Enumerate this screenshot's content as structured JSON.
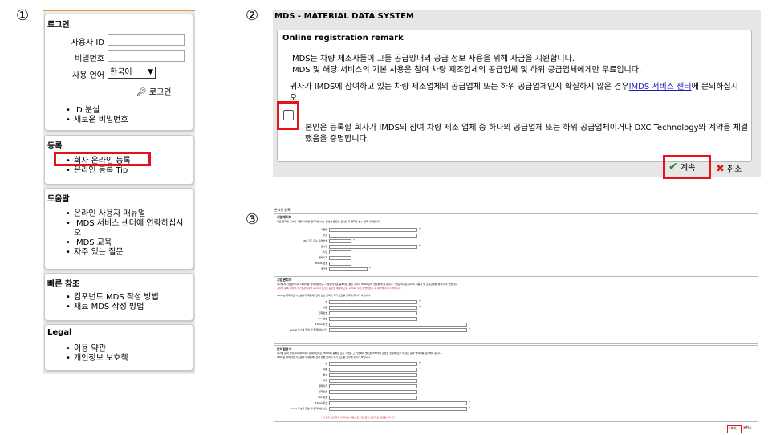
{
  "steps": [
    "①",
    "②",
    "③"
  ],
  "nav": {
    "login": {
      "title": "로그인",
      "user_id_label": "사용자 ID",
      "user_id_value": "",
      "password_label": "비밀번호",
      "password_value": "",
      "language_label": "사용 언어",
      "language_selected": "한국어",
      "login_button": "로그인",
      "links": [
        "ID 분실",
        "새로운 비밀번호"
      ]
    },
    "registration": {
      "title": "등록",
      "links": [
        "회사 온라인 등록",
        "온라인 등록 Tip"
      ]
    },
    "help": {
      "title": "도움말",
      "links": [
        "온라인 사용자 매뉴얼",
        "IMDS 서비스 센터에 연락하십시오",
        "IMDS 교육",
        "자주 있는 질문"
      ]
    },
    "quick": {
      "title": "빠른 참조",
      "links": [
        "컴포넌트 MDS 작성 방법",
        "재료 MDS 작성 방법"
      ]
    },
    "legal": {
      "title": "Legal",
      "links": [
        "이용 약관",
        "개인정보 보호책"
      ]
    }
  },
  "remark": {
    "system_title": "MDS - MATERIAL DATA SYSTEM",
    "box_title": "Online registration remark",
    "para1_line1": "IMDS는 차량 제조사들이 그들 공급망내의 공급 정보 사용을 위해 자금을 지원합니다.",
    "para1_line2": "IMDS 및 해당 서비스의 기본 사용은 참여 차량 제조업체의 공급업체 및 하위 공급업체에게만 무료입니다.",
    "para2_before": "귀사가 IMDS에 참여하고 있는 차량 제조업체의 공급업체 또는 하위 공급업체인지 확실하지 않은 경우",
    "para2_link": "IMDS 서비스 센터",
    "para2_after": "에 문의하십시오.",
    "consent_line1": "본인은 등록할 회사가 IMDS의 참여 차량 제조 업체 중 하나의 공급업체 또는 하위 공급업체이거나 DXC Technology와 계약을 체결",
    "consent_line2": "했음을 증명합니다.",
    "continue_button": "계속",
    "cancel_button": "취소"
  },
  "form": {
    "title": "온라인 등록",
    "sections": [
      {
        "title": "기업데이터",
        "desc": "다음 항목에 귀사의 기업데이터를 입력하십시오. 본인의 별표로 표시된 각 항목은 필수 입력 사항입니다.",
        "fields": [
          "기업명",
          "주소",
          "Zip 코드 또는 우편번호",
          "도시명",
          "주/도",
          "웹페이지",
          "DUNS 번호",
          "국가명"
        ]
      },
      {
        "title": "기업관리자",
        "desc": "여기에서 기업관리자의 데이터를 입력하십시오. 기업관리자로 등록되는 분은 귀사의 IMDS 관리 업무를 맡게 됩니다. 기업관리자는 귀사의 사용자 및 조직단위를 생성할 수 있습니다.",
        "desc_red": "귀사의 등록 데이터가 기업관리자의 e-mail 주소로 승인될 예정이므로, e-mail 주소가 올바른지 꼭 확인해 주시기 바랍니다.",
        "desc2": "IMDS는 국제적인 시스템이기 때문에, 전화 번호 입력시 국가 코드를 입력해 주시기 바랍니다.",
        "fields": [
          "성",
          "이름",
          "전화번호",
          "Fax 번호",
          "E-Mail 주소",
          "e-mail 주소를 한번 더 입력하십시오."
        ]
      },
      {
        "title": "문의담당자",
        "desc": "여기에 문의 담당자의 데이터를 입력하십시오. IMDS에 등록된 모든 기업은 그 기업에서 발신된 IMDS와 관련된 질문에 답할 수 있는 문의 연락처를 입력해야 합니다.",
        "desc2": "IMDS는 국제적인 시스템이기 때문에, 전화 번호 입력시 국가 코드를 입력해 주시기 바랍니다.",
        "fields": [
          "성",
          "이름",
          "부서",
          "직위",
          "웹페이지",
          "전화번호",
          "Fax 번호",
          "E-Mail 주소",
          "e-mail 주소를 한번 더 입력하십시오."
        ]
      }
    ],
    "note": "이 문의 담당자의 연락처는 자동으로 기본 문의 담당자로 설정됩니다.",
    "continue_button": "계속",
    "cancel_button": "취소"
  },
  "colors": {
    "highlight": "#e5121b",
    "accent_line": "#e89a2c",
    "check": "#1d8a1d",
    "cancel": "#d42020"
  }
}
